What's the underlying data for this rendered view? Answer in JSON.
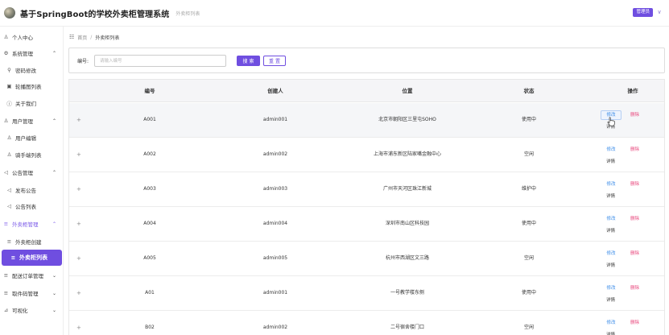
{
  "header": {
    "title": "基于SpringBoot的学校外卖柜管理系统",
    "subtitle": "外卖柜列表",
    "user_badge": "管理员",
    "user_chevron": "∨"
  },
  "sidebar": {
    "items": [
      {
        "label": "个人中心",
        "icon": "user-icon",
        "glyph": "♙"
      },
      {
        "label": "系统管理",
        "icon": "gear-icon",
        "glyph": "⚙",
        "chevron": "⌃"
      },
      {
        "label": "密码修改",
        "icon": "key-icon",
        "glyph": "⚲"
      },
      {
        "label": "轮播图列表",
        "icon": "image-icon",
        "glyph": "▣"
      },
      {
        "label": "关于我们",
        "icon": "info-icon",
        "glyph": "ⓘ"
      },
      {
        "label": "用户管理",
        "icon": "users-icon",
        "glyph": "♙",
        "chevron": "⌃"
      },
      {
        "label": "用户编辑",
        "icon": "user-icon",
        "glyph": "♙"
      },
      {
        "label": "骑手端列表",
        "icon": "user-icon",
        "glyph": "♙"
      },
      {
        "label": "公告管理",
        "icon": "megaphone-icon",
        "glyph": "◁",
        "chevron": "⌃"
      },
      {
        "label": "发布公告",
        "icon": "megaphone-icon",
        "glyph": "◁"
      },
      {
        "label": "公告列表",
        "icon": "megaphone-icon",
        "glyph": "◁"
      },
      {
        "label": "外卖柜管理",
        "icon": "list-icon",
        "glyph": "≡",
        "chevron": "⌃"
      },
      {
        "label": "外卖柜创建",
        "icon": "list-icon",
        "glyph": "≡"
      },
      {
        "label": "外卖柜列表",
        "icon": "list-icon",
        "glyph": "≡"
      },
      {
        "label": "配送订单管理",
        "icon": "list-icon",
        "glyph": "≡",
        "chevron": "⌄"
      },
      {
        "label": "取件码管理",
        "icon": "list-icon",
        "glyph": "≡",
        "chevron": "⌄"
      },
      {
        "label": "可视化",
        "icon": "chart-icon",
        "glyph": "⊿",
        "chevron": "⌄"
      }
    ]
  },
  "breadcrumb": {
    "icon_glyph": "☷",
    "home": "首页",
    "separator": "/",
    "current": "外卖柜列表"
  },
  "search": {
    "label": "编号:",
    "placeholder": "请输入编号",
    "search_button": "搜 索",
    "reset_button": "重 置"
  },
  "table": {
    "columns": [
      "编号",
      "创建人",
      "位置",
      "状态",
      "操作"
    ],
    "expand_glyph": "+",
    "edit_label": "修改",
    "delete_label": "删除",
    "detail_label": "详情",
    "rows": [
      {
        "code": "A001",
        "creator": "admin001",
        "location": "北京市朝阳区三里屯SOHO",
        "status": "使用中"
      },
      {
        "code": "A002",
        "creator": "admin002",
        "location": "上海市浦东新区陆家嘴金融中心",
        "status": "空闲"
      },
      {
        "code": "A003",
        "creator": "admin003",
        "location": "广州市天河区珠江新城",
        "status": "维护中"
      },
      {
        "code": "A004",
        "creator": "admin004",
        "location": "深圳市南山区科技园",
        "status": "使用中"
      },
      {
        "code": "A005",
        "creator": "admin005",
        "location": "杭州市西湖区文三路",
        "status": "空闲"
      },
      {
        "code": "A01",
        "creator": "admin001",
        "location": "一号教学楼东侧",
        "status": "使用中"
      },
      {
        "code": "B02",
        "creator": "admin002",
        "location": "二号宿舍楼门口",
        "status": "空闲"
      }
    ]
  },
  "colors": {
    "accent": "#6f4ee0",
    "link": "#3b8ce8",
    "danger": "#e8467c"
  }
}
